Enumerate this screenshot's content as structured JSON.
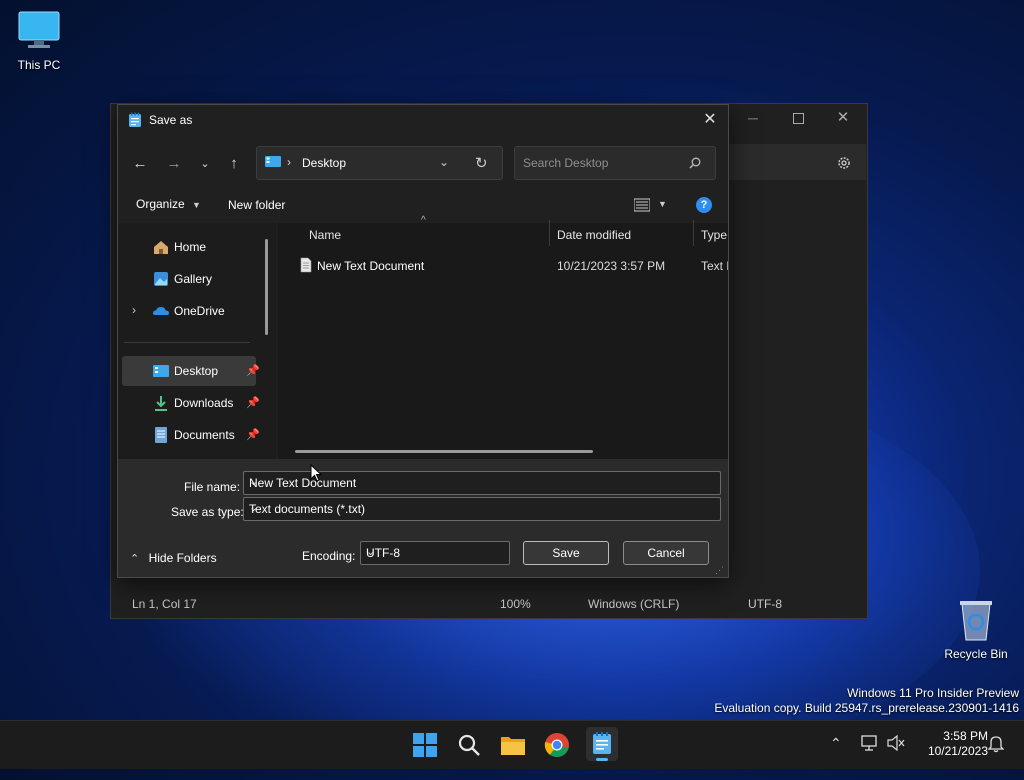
{
  "desktop": {
    "this_pc_label": "This PC",
    "recycle_bin_label": "Recycle Bin",
    "watermark_line1": "Windows 11 Pro Insider Preview",
    "watermark_line2": "Evaluation copy. Build 25947.rs_prerelease.230901-1416"
  },
  "notepad": {
    "status_position": "Ln 1, Col 17",
    "status_zoom": "100%",
    "status_line_endings": "Windows (CRLF)",
    "status_encoding": "UTF-8"
  },
  "dialog": {
    "title": "Save as",
    "address_current": "Desktop",
    "search_placeholder": "Search Desktop",
    "toolbar": {
      "organize": "Organize",
      "new_folder": "New folder"
    },
    "sidebar": {
      "items": [
        {
          "label": "Home",
          "icon": "home-icon"
        },
        {
          "label": "Gallery",
          "icon": "gallery-icon"
        },
        {
          "label": "OneDrive",
          "icon": "onedrive-icon"
        },
        {
          "label": "Desktop",
          "icon": "desktop-folder-icon"
        },
        {
          "label": "Downloads",
          "icon": "downloads-icon"
        },
        {
          "label": "Documents",
          "icon": "documents-icon"
        }
      ]
    },
    "columns": {
      "name": "Name",
      "date_modified": "Date modified",
      "type": "Type"
    },
    "files": [
      {
        "name": "New Text Document",
        "date_modified": "10/21/2023 3:57 PM",
        "type": "Text D"
      }
    ],
    "file_name_label": "File name:",
    "file_name_value": "New Text Document",
    "save_as_type_label": "Save as type:",
    "save_as_type_value": "Text documents (*.txt)",
    "hide_folders": "Hide Folders",
    "encoding_label": "Encoding:",
    "encoding_value": "UTF-8",
    "save_button": "Save",
    "cancel_button": "Cancel"
  },
  "tray": {
    "time": "3:58 PM",
    "date": "10/21/2023"
  },
  "colors": {
    "accent": "#0078d4",
    "dialog_bg": "#202020",
    "selected_bg": "#3a3a3a"
  }
}
